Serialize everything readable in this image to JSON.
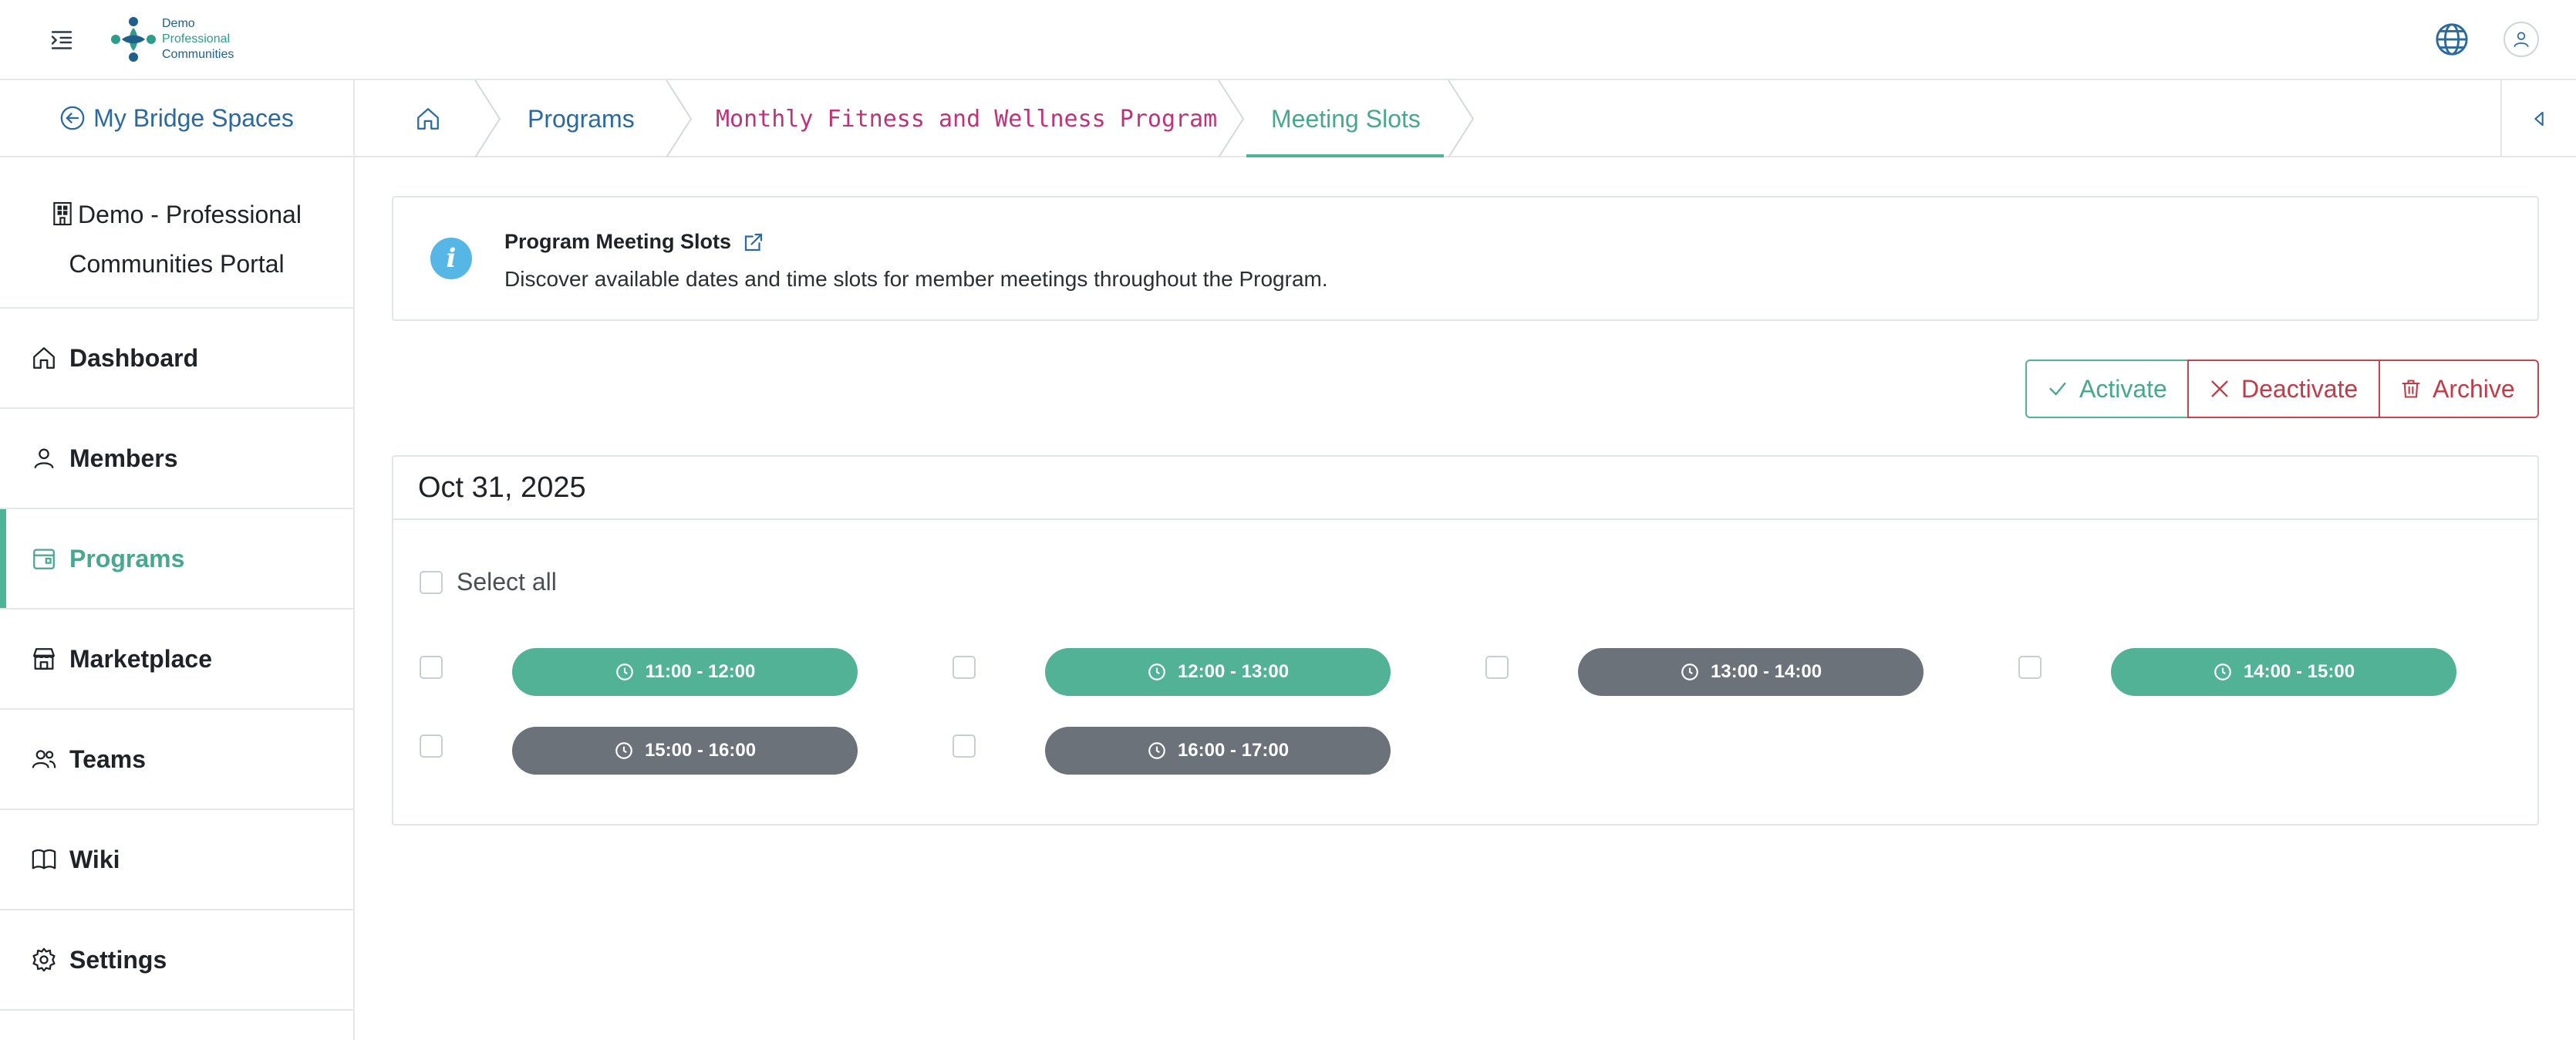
{
  "logo": {
    "line1": "Demo",
    "line2": "Professional",
    "line3": "Communities"
  },
  "sidebar": {
    "back_label": "My Bridge Spaces",
    "org_name": "Demo - Professional Communities Portal",
    "items": [
      {
        "label": "Dashboard",
        "icon": "home-icon"
      },
      {
        "label": "Members",
        "icon": "user-icon"
      },
      {
        "label": "Programs",
        "icon": "calendar-icon",
        "active": true
      },
      {
        "label": "Marketplace",
        "icon": "store-icon"
      },
      {
        "label": "Teams",
        "icon": "users-icon"
      },
      {
        "label": "Wiki",
        "icon": "book-icon"
      },
      {
        "label": "Settings",
        "icon": "gear-icon"
      }
    ]
  },
  "breadcrumb": {
    "programs": "Programs",
    "program_name": "Monthly Fitness and Wellness Program",
    "current": "Meeting Slots"
  },
  "info": {
    "title": "Program Meeting Slots",
    "description": "Discover available dates and time slots for member meetings throughout the Program."
  },
  "actions": {
    "activate": "Activate",
    "deactivate": "Deactivate",
    "archive": "Archive"
  },
  "date_panel": {
    "date": "Oct 31, 2025",
    "select_all": "Select all",
    "slots": [
      {
        "time": "11:00 - 12:00",
        "active": true
      },
      {
        "time": "12:00 - 13:00",
        "active": true
      },
      {
        "time": "13:00 - 14:00",
        "active": false
      },
      {
        "time": "14:00 - 15:00",
        "active": true
      },
      {
        "time": "15:00 - 16:00",
        "active": false
      },
      {
        "time": "16:00 - 17:00",
        "active": false
      }
    ]
  },
  "colors": {
    "accent": "#4fb396",
    "link": "#2a6aa0",
    "program_text": "#c0337a",
    "danger": "#c9434f",
    "inactive_slot": "#6c727a"
  }
}
